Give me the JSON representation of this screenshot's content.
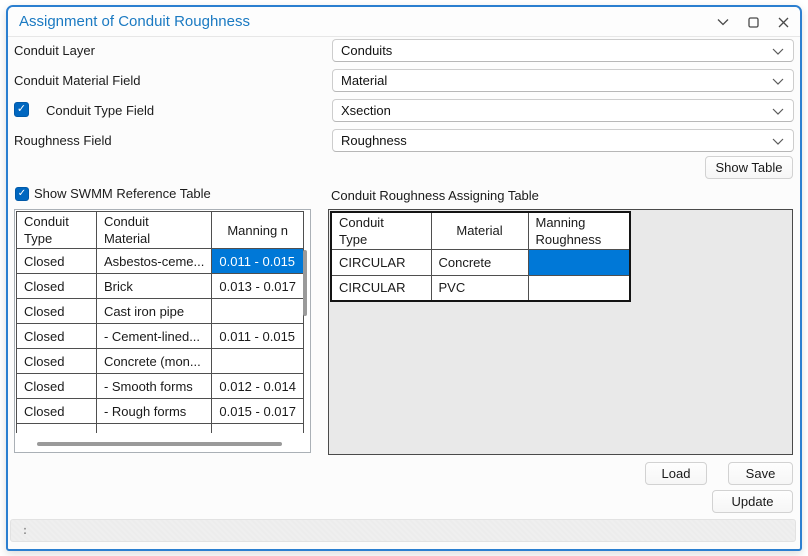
{
  "window": {
    "title": "Assignment of Conduit Roughness"
  },
  "icons": {
    "checkmark": "✓",
    "dropdown_chevron": "chevron-down",
    "window_controls": [
      "chevron-down",
      "maximize-square",
      "close-x"
    ]
  },
  "form": {
    "fields": [
      {
        "label": "Conduit Layer",
        "value": "Conduits",
        "has_checkbox": false
      },
      {
        "label": "Conduit Material Field",
        "value": "Material",
        "has_checkbox": false
      },
      {
        "label": "Conduit Type Field",
        "value": "Xsection",
        "has_checkbox": true,
        "checked": true
      },
      {
        "label": "Roughness Field",
        "value": "Roughness",
        "has_checkbox": false
      }
    ],
    "show_table_button": "Show Table"
  },
  "reference": {
    "checkbox_label": "Show SWMM Reference Table",
    "checked": true,
    "table": {
      "headers": [
        "Conduit\nType",
        "Conduit\nMaterial",
        "Manning n"
      ],
      "rows": [
        [
          "Closed",
          "Asbestos-ceme...",
          "0.011 - 0.015"
        ],
        [
          "Closed",
          "Brick",
          "0.013 - 0.017"
        ],
        [
          "Closed",
          "Cast iron pipe",
          ""
        ],
        [
          "Closed",
          "- Cement-lined...",
          "0.011 - 0.015"
        ],
        [
          "Closed",
          "Concrete (mon...",
          ""
        ],
        [
          "Closed",
          "- Smooth forms",
          "0.012 - 0.014"
        ],
        [
          "Closed",
          "- Rough forms",
          "0.015 - 0.017"
        ],
        [
          "",
          "",
          ""
        ]
      ],
      "selected_cell": {
        "row": 0,
        "col": 2
      }
    }
  },
  "assigning": {
    "label": "Conduit Roughness Assigning Table",
    "table": {
      "headers": [
        "Conduit\nType",
        "Material",
        "Manning\nRoughness"
      ],
      "rows": [
        [
          "CIRCULAR",
          "Concrete",
          ""
        ],
        [
          "CIRCULAR",
          "PVC",
          ""
        ]
      ],
      "selected_cell": {
        "row": 0,
        "col": 2
      }
    }
  },
  "buttons": {
    "load": "Load",
    "save": "Save",
    "update": "Update"
  },
  "statusbar": {
    "text": ":"
  },
  "colors": {
    "accent_border": "#2b7fd0",
    "title_text": "#1b7ac2",
    "checkbox_fill": "#0067c0",
    "selection": "#0078d7",
    "panel_fill": "#e9e9e9"
  }
}
